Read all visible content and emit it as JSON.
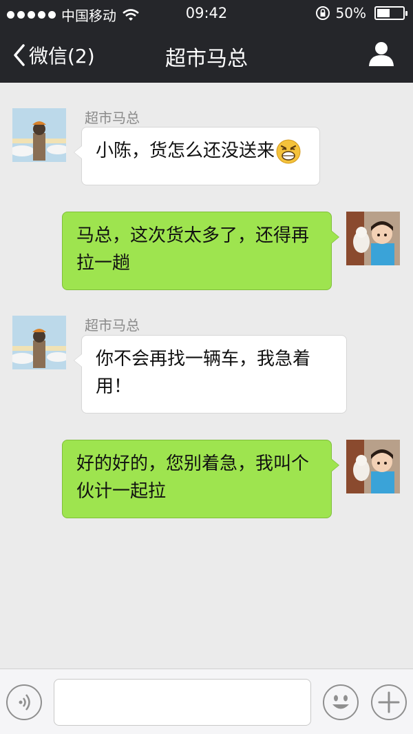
{
  "status_bar": {
    "carrier": "中国移动",
    "time": "09:42",
    "battery": "50%",
    "battery_level": 0.5
  },
  "nav": {
    "back_label": "微信(2)",
    "title": "超市马总",
    "profile_icon": "person-icon"
  },
  "messages": [
    {
      "direction": "in",
      "sender": "超市马总",
      "text": "小陈，货怎么还没送来",
      "emoji": "angry-face"
    },
    {
      "direction": "out",
      "text": "马总，这次货太多了，还得再拉一趟"
    },
    {
      "direction": "in",
      "sender": "超市马总",
      "text": "你不会再找一辆车，我急着用！"
    },
    {
      "direction": "out",
      "text": "好的好的，您别着急，我叫个伙计一起拉"
    }
  ],
  "input_bar": {
    "voice_icon": "voice-icon",
    "emoji_icon": "smiley-icon",
    "add_icon": "plus-icon",
    "message_value": ""
  },
  "colors": {
    "header_bg": "#25262a",
    "chat_bg": "#ebebeb",
    "out_bubble": "#9ee44f",
    "in_bubble": "#ffffff"
  }
}
